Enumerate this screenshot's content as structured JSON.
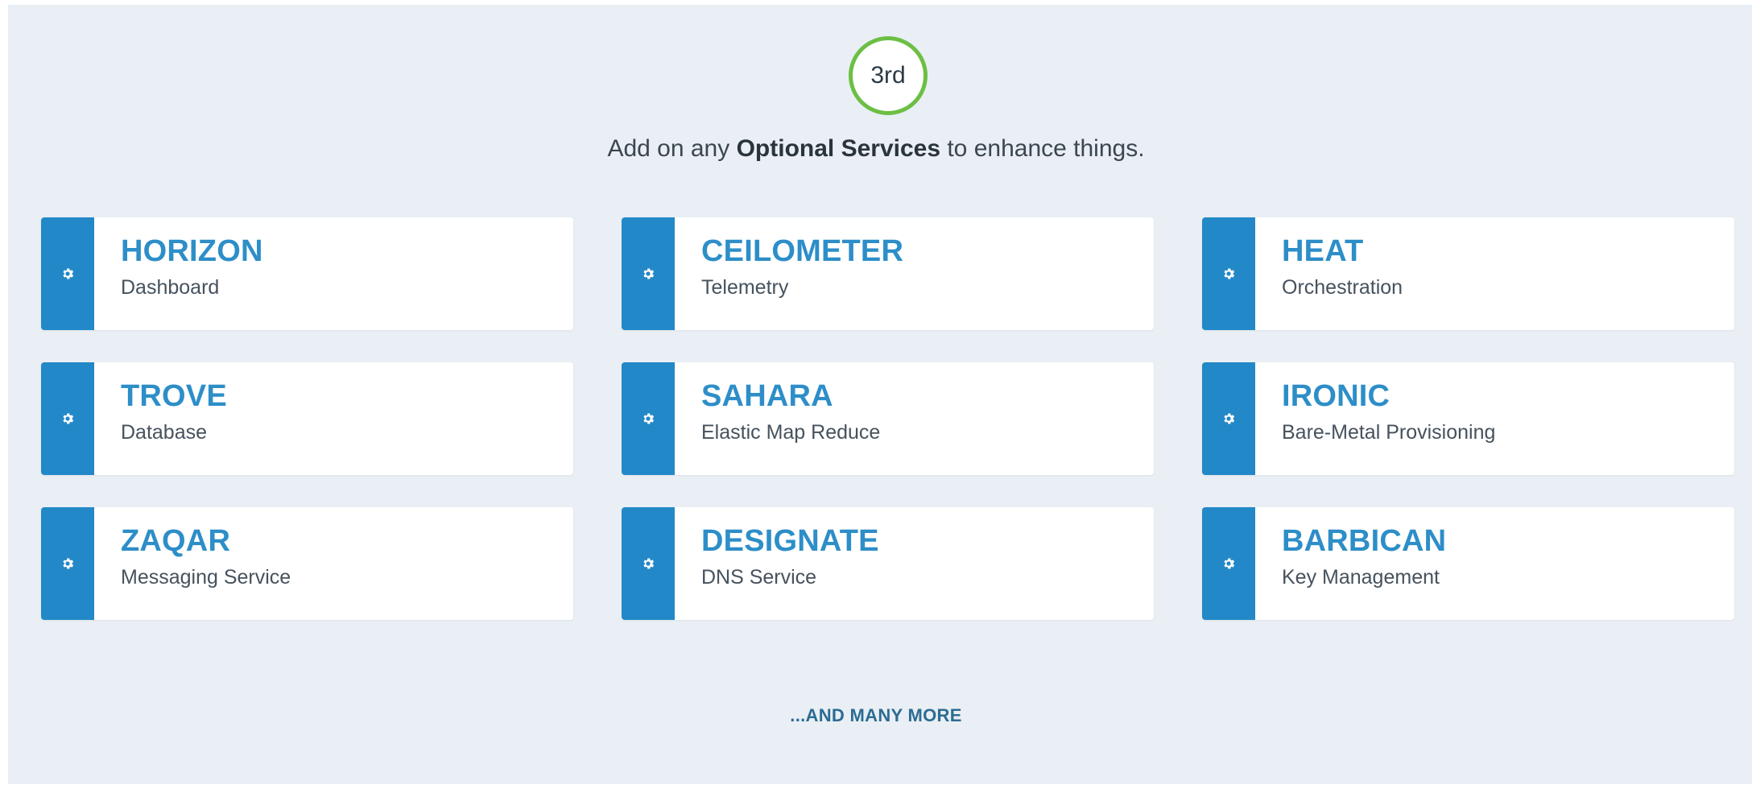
{
  "step": {
    "badge": "3rd"
  },
  "intro": {
    "prefix": "Add on any ",
    "emphasis": "Optional Services",
    "suffix": " to enhance things."
  },
  "services": [
    {
      "name": "HORIZON",
      "description": "Dashboard",
      "icon": "gear-icon"
    },
    {
      "name": "CEILOMETER",
      "description": "Telemetry",
      "icon": "gear-icon"
    },
    {
      "name": "HEAT",
      "description": "Orchestration",
      "icon": "gear-icon"
    },
    {
      "name": "TROVE",
      "description": "Database",
      "icon": "gear-icon"
    },
    {
      "name": "SAHARA",
      "description": "Elastic Map Reduce",
      "icon": "gear-icon"
    },
    {
      "name": "IRONIC",
      "description": "Bare-Metal Provisioning",
      "icon": "gear-icon"
    },
    {
      "name": "ZAQAR",
      "description": "Messaging Service",
      "icon": "gear-icon"
    },
    {
      "name": "DESIGNATE",
      "description": "DNS Service",
      "icon": "gear-icon"
    },
    {
      "name": "BARBICAN",
      "description": "Key Management",
      "icon": "gear-icon"
    }
  ],
  "more": {
    "label": "...AND MANY MORE"
  },
  "colors": {
    "accent": "#2388c7",
    "badge_ring": "#6cbf44",
    "background": "#e9eff4"
  }
}
